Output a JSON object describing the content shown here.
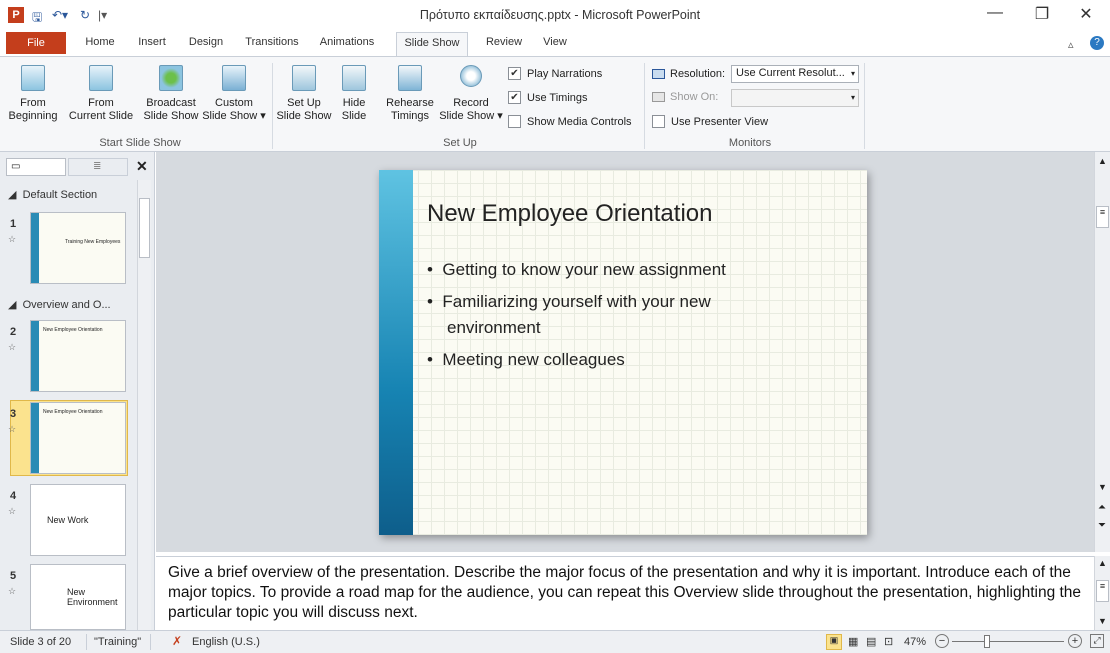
{
  "window": {
    "title": "Πρότυπο εκπαίδευσης.pptx - Microsoft PowerPoint"
  },
  "tabs": [
    "File",
    "Home",
    "Insert",
    "Design",
    "Transitions",
    "Animations",
    "Slide Show",
    "Review",
    "View"
  ],
  "ribbon": {
    "from_beginning": [
      "From",
      "Beginning"
    ],
    "from_current": [
      "From",
      "Current Slide"
    ],
    "broadcast": [
      "Broadcast",
      "Slide Show"
    ],
    "custom": [
      "Custom",
      "Slide Show ▾"
    ],
    "group_start": "Start Slide Show",
    "setup": [
      "Set Up",
      "Slide Show"
    ],
    "hide": [
      "Hide",
      "Slide"
    ],
    "rehearse": [
      "Rehearse",
      "Timings"
    ],
    "record": [
      "Record",
      "Slide Show ▾"
    ],
    "play_narrations": "Play Narrations",
    "use_timings": "Use Timings",
    "show_media": "Show Media Controls",
    "group_setup": "Set Up",
    "resolution_label": "Resolution:",
    "resolution_value": "Use Current Resolut...",
    "show_on_label": "Show On:",
    "presenter_view": "Use Presenter View",
    "group_monitors": "Monitors"
  },
  "pane": {
    "sections": [
      "Default Section",
      "Overview and O..."
    ],
    "thumbs": [
      {
        "num": "1",
        "text": "Training New Employees"
      },
      {
        "num": "2",
        "text": "New Employee Orientation"
      },
      {
        "num": "3",
        "text": "New Employee Orientation"
      },
      {
        "num": "4",
        "text": "New Work"
      },
      {
        "num": "5",
        "text": "New Environment"
      }
    ]
  },
  "slide": {
    "title": "New Employee Orientation",
    "bullets": [
      "Getting to know your new assignment",
      "Familiarizing yourself with your new",
      "environment",
      "Meeting new colleagues"
    ]
  },
  "notes": "Give a brief overview of the presentation. Describe the major focus of the presentation and why it is important. Introduce each of the major topics. To provide a road map for the audience, you can repeat this Overview slide throughout the presentation, highlighting the particular topic you will discuss next.",
  "status": {
    "slide": "Slide 3 of 20",
    "theme": "\"Training\"",
    "language": "English (U.S.)",
    "zoom": "47%"
  }
}
